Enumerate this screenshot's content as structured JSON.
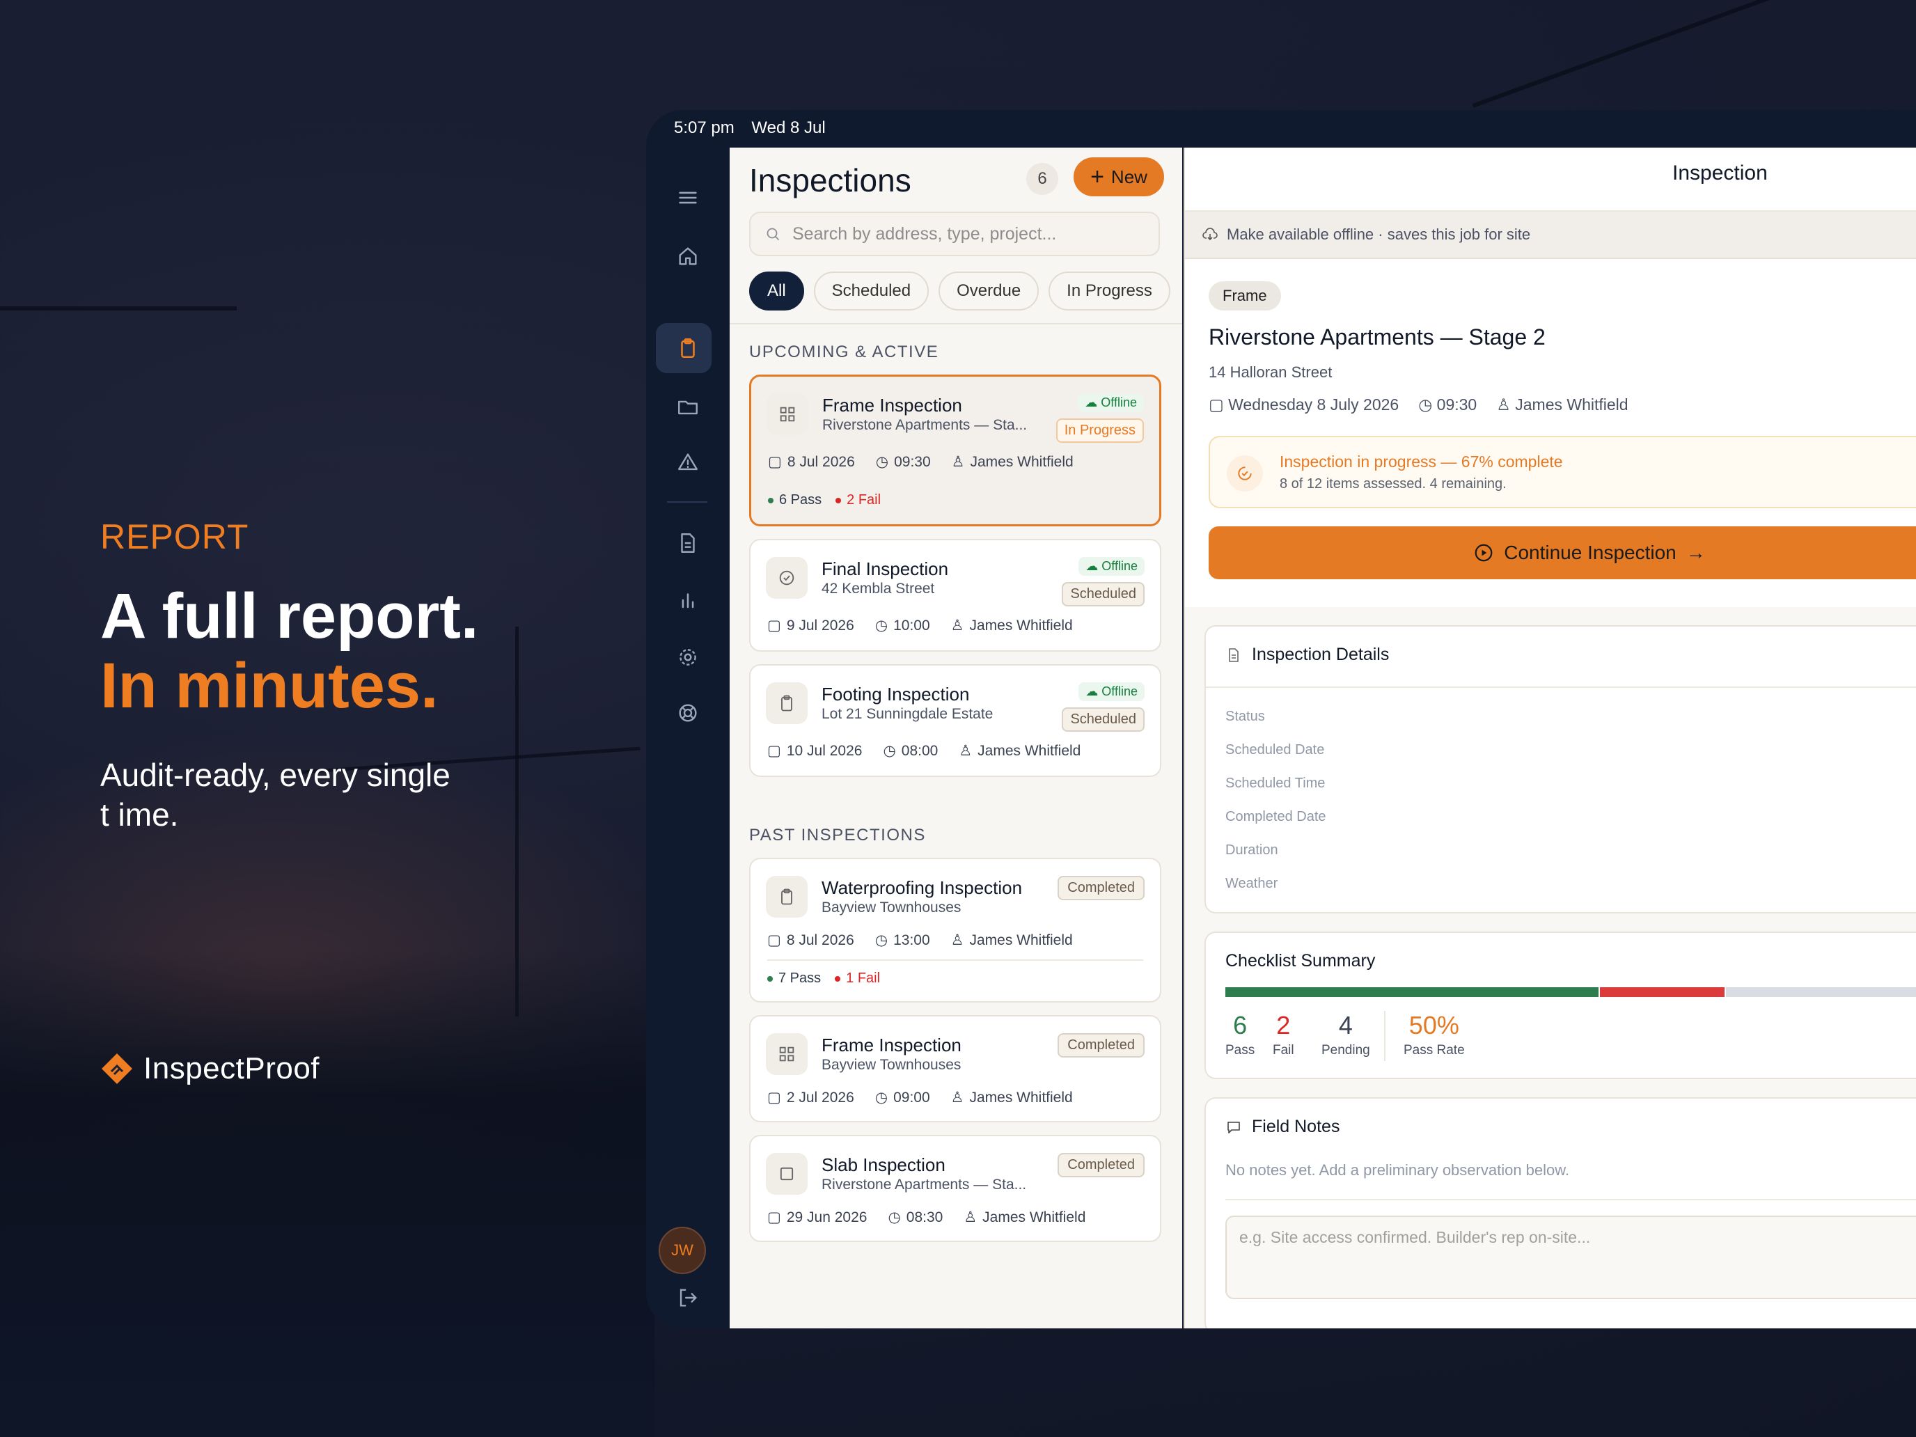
{
  "marketing": {
    "kicker": "REPORT",
    "headline_1": "A full report.",
    "headline_2": "In minutes.",
    "subline": "Audit-ready, every single t ime.",
    "brand": "InspectProof"
  },
  "statusbar": {
    "time": "5:07 pm",
    "date": "Wed 8 Jul"
  },
  "sidebar": {
    "icons": [
      "menu-icon",
      "home-icon",
      "clipboard-icon",
      "folder-icon",
      "alert-icon",
      "document-icon",
      "chart-icon",
      "gear-icon",
      "lifebuoy-icon"
    ],
    "avatar_initials": "JW",
    "active_item": "clipboard-icon"
  },
  "list": {
    "title": "Inspections",
    "count": "6",
    "new_label": "New",
    "search_placeholder": "Search by address, type, project...",
    "filters": [
      "All",
      "Scheduled",
      "Overdue",
      "In Progress"
    ],
    "active_filter": "All",
    "section_active": "UPCOMING & ACTIVE",
    "section_past": "PAST INSPECTIONS",
    "offline_label": "Offline",
    "upcoming": [
      {
        "title": "Frame Inspection",
        "sub": "Riverstone Apartments — Sta...",
        "status": "In Progress",
        "date": "8 Jul 2026",
        "time": "09:30",
        "inspector": "James Whitfield",
        "pass": "6 Pass",
        "fail": "2 Fail"
      },
      {
        "title": "Final Inspection",
        "sub": "42 Kembla Street",
        "status": "Scheduled",
        "date": "9 Jul 2026",
        "time": "10:00",
        "inspector": "James Whitfield"
      },
      {
        "title": "Footing Inspection",
        "sub": "Lot 21 Sunningdale Estate",
        "status": "Scheduled",
        "date": "10 Jul 2026",
        "time": "08:00",
        "inspector": "James Whitfield"
      }
    ],
    "past": [
      {
        "title": "Waterproofing Inspection",
        "sub": "Bayview Townhouses",
        "status": "Completed",
        "date": "8 Jul 2026",
        "time": "13:00",
        "inspector": "James Whitfield",
        "pass": "7 Pass",
        "fail": "1 Fail"
      },
      {
        "title": "Frame Inspection",
        "sub": "Bayview Townhouses",
        "status": "Completed",
        "date": "2 Jul 2026",
        "time": "09:00",
        "inspector": "James Whitfield"
      },
      {
        "title": "Slab Inspection",
        "sub": "Riverstone Apartments — Sta...",
        "status": "Completed",
        "date": "29 Jun 2026",
        "time": "08:30",
        "inspector": "James Whitfield"
      }
    ]
  },
  "detail": {
    "header_title": "Inspection",
    "offline_text": "Make available offline · saves this job for site",
    "type_pill": "Frame",
    "title": "Riverstone Apartments — Stage 2",
    "address": "14 Halloran Street",
    "date": "Wednesday 8 July 2026",
    "time": "09:30",
    "inspector": "James Whitfield",
    "progress_title": "Inspection in progress — 67% complete",
    "progress_sub": "8 of 12 items assessed. 4 remaining.",
    "progress_fraction": 0.67,
    "continue_label": "Continue Inspection",
    "details_title": "Inspection Details",
    "details_fields": [
      "Status",
      "Scheduled Date",
      "Scheduled Time",
      "Completed Date",
      "Duration",
      "Weather"
    ],
    "checklist_title": "Checklist Summary",
    "checklist": {
      "pass": "6",
      "pass_label": "Pass",
      "fail": "2",
      "fail_label": "Fail",
      "pending": "4",
      "pending_label": "Pending",
      "rate": "50%",
      "rate_label": "Pass Rate"
    },
    "notes_title": "Field Notes",
    "notes_empty": "No notes yet. Add a preliminary observation below.",
    "notes_placeholder": "e.g. Site access confirmed. Builder's rep on-site..."
  },
  "colors": {
    "accent": "#e57a25",
    "navy": "#13203a",
    "pass": "#2e7d4f",
    "fail": "#dc2626"
  }
}
